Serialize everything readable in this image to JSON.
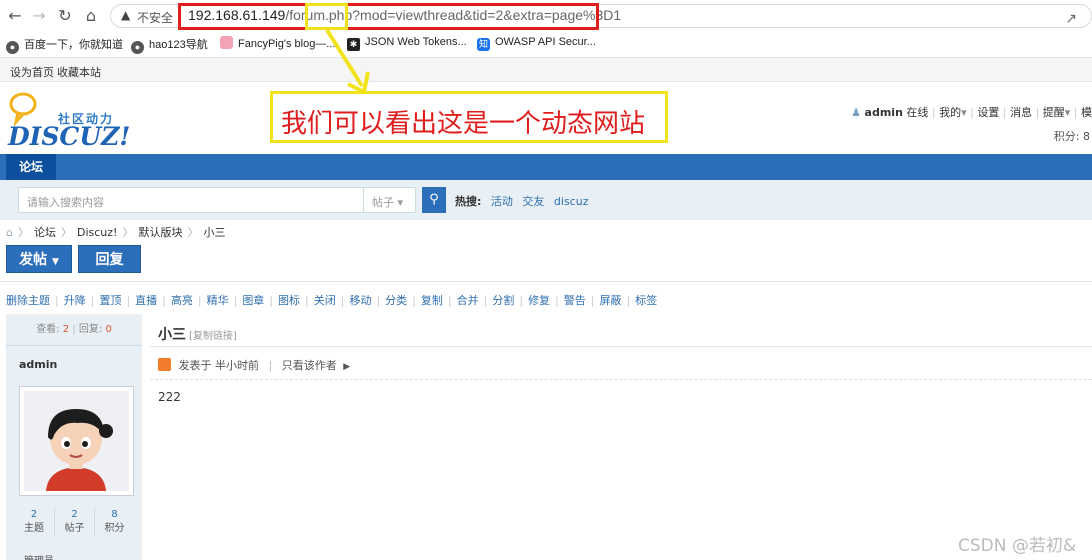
{
  "browser": {
    "insecure_label": "不安全",
    "url_host": "192.168.61.149",
    "url_path": "/forum.php?mod=viewthread&tid=2&extra=page%3D1",
    "bookmarks": [
      {
        "label": "百度一下，你就知道",
        "icon": "globe-icon"
      },
      {
        "label": "hao123导航",
        "icon": "globe-icon"
      },
      {
        "label": "FancyPig's blog—...",
        "icon": "pig-icon"
      },
      {
        "label": "JSON Web Tokens...",
        "icon": "jwt-icon"
      },
      {
        "label": "OWASP API Secur...",
        "icon": "zhi-icon"
      }
    ]
  },
  "topbar": {
    "set_home": "设为首页",
    "bookmark_site": "收藏本站"
  },
  "header": {
    "logo_cn": "社区动力",
    "logo_en": "DISCUZ!",
    "user": "admin",
    "online": "在线",
    "my": "我的",
    "settings": "设置",
    "messages": "消息",
    "reminders": "提醒",
    "more": "模",
    "points": "积分: 8"
  },
  "annotation": "我们可以看出这是一个动态网站",
  "nav": {
    "forum": "论坛"
  },
  "search": {
    "placeholder": "请输入搜索内容",
    "type": "帖子",
    "hot_label": "热搜:",
    "hot_terms": [
      "活动",
      "交友",
      "discuz"
    ]
  },
  "breadcrumb": [
    "论坛",
    "Discuz!",
    "默认版块",
    "小三"
  ],
  "buttons": {
    "post": "发帖",
    "reply": "回复"
  },
  "mod_actions": [
    "删除主题",
    "升降",
    "置顶",
    "直播",
    "高亮",
    "精华",
    "图章",
    "图标",
    "关闭",
    "移动",
    "分类",
    "复制",
    "合并",
    "分割",
    "修复",
    "警告",
    "屏蔽",
    "标签"
  ],
  "sidebar": {
    "views_label": "查看:",
    "views": "2",
    "replies_label": "回复:",
    "replies": "0",
    "author": "admin",
    "stats": [
      {
        "value": "2",
        "label": "主题"
      },
      {
        "value": "2",
        "label": "帖子"
      },
      {
        "value": "8",
        "label": "积分"
      }
    ],
    "role": "管理员"
  },
  "post": {
    "title": "小三",
    "copy_link": "[复制链接]",
    "posted_at": "发表于 半小时前",
    "only_author": "只看该作者",
    "body": "222"
  },
  "watermark": "CSDN @若初&",
  "colors": {
    "accent": "#2b6fba",
    "annotation_red": "#e01e1e",
    "annotation_yellow": "#f2e21b"
  }
}
